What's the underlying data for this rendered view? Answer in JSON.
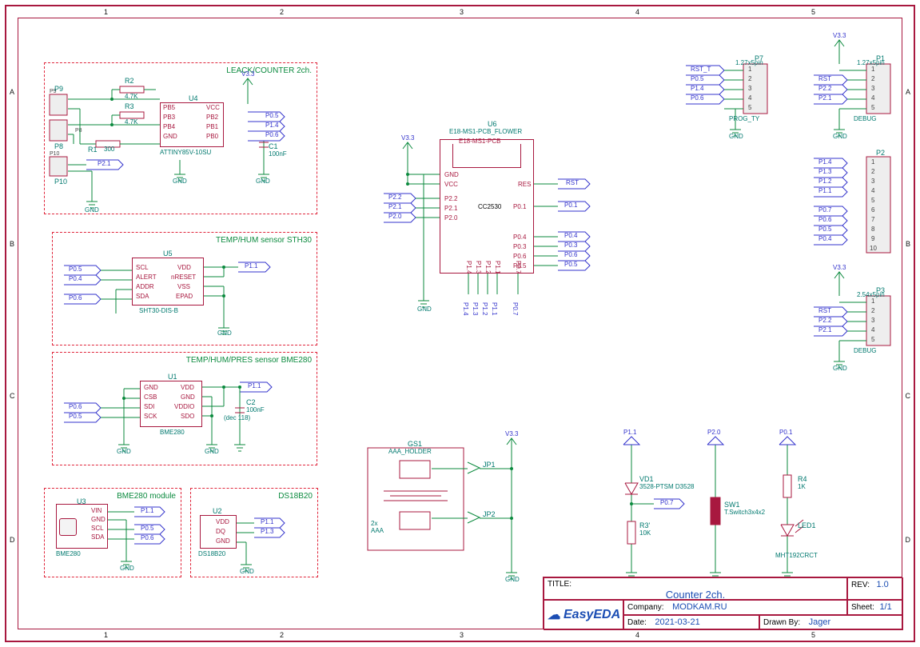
{
  "ruler": {
    "cols": [
      "1",
      "2",
      "3",
      "4",
      "5"
    ],
    "rows": [
      "A",
      "B",
      "C",
      "D"
    ]
  },
  "blocks": {
    "leack": {
      "title": "LEACK/COUNTER 2ch.",
      "u4_ref": "U4",
      "u4_val": "ATTINY85V-10SU",
      "r2_ref": "R2",
      "r2_val": "4.7K",
      "r3_ref": "R3",
      "r3_val": "4.7K",
      "r1_ref": "R1",
      "r1_val": "300",
      "c1_ref": "C1",
      "c1_val": "100nF",
      "p9_ref": "P9",
      "p8_ref": "P8",
      "p10_ref": "P10",
      "v33": "V3.3",
      "u4_pins_left": [
        "PB5",
        "PB3",
        "PB4",
        "GND"
      ],
      "u4_pins_right": [
        "VCC",
        "PB2",
        "PB1",
        "PB0"
      ],
      "nets_right": [
        "P0.5",
        "P1.4",
        "P0.6"
      ],
      "net_p10": "P2.1"
    },
    "sth30": {
      "title": "TEMP/HUM sensor STH30",
      "u5_ref": "U5",
      "u5_val": "SHT30-DIS-B",
      "pins_left": [
        "SCL",
        "ALERT",
        "ADDR",
        "SDA"
      ],
      "pins_right": [
        "VDD",
        "nRESET",
        "VSS",
        "EPAD"
      ],
      "net_scl": "P0.5",
      "net_alert": "P0.4",
      "net_sda": "P0.6",
      "net_vdd": "P1.1"
    },
    "bme280": {
      "title": "TEMP/HUM/PRES sensor BME280",
      "u1_ref": "U1",
      "u1_val": "BME280",
      "pins_left": [
        "GND",
        "CSB",
        "SDI",
        "SCK"
      ],
      "pins_right": [
        "VDD",
        "GND",
        "VDDIO",
        "SDO"
      ],
      "c2_ref": "C2",
      "c2_val": "100nF",
      "note": "(dec 118)",
      "net_sdi": "P0.6",
      "net_sck": "P0.5",
      "net_vdd": "P1.1"
    },
    "bme280_mod": {
      "title": "BME280 module",
      "u3_ref": "U3",
      "u3_val": "BME280",
      "pins": [
        "VIN",
        "GND",
        "SCL",
        "SDA"
      ],
      "net_vin": "P1.1",
      "net_scl": "P0.5",
      "net_sda": "P0.6"
    },
    "ds18b20": {
      "title": "DS18B20",
      "u2_ref": "U2",
      "u2_val": "DS18B20",
      "pins": [
        "VDD",
        "DQ",
        "GND"
      ],
      "net_vdd": "P1.1",
      "net_dq": "P1.3"
    }
  },
  "main_ic": {
    "ref": "U6",
    "lib": "E18-MS1-PCB_FLOWER",
    "val": "E18-MS1-PCB",
    "chip": "CC2530",
    "v33": "V3.3",
    "left_pins": [
      "GND",
      "VCC",
      "P2.2",
      "P2.1",
      "P2.0"
    ],
    "left_nets": [
      "P2.2",
      "P2.1",
      "P2.0"
    ],
    "right_res": "RES",
    "right_res_net": "RST",
    "right_p01": "P0.1",
    "right_p01_net": "P0.1",
    "right_bot_pins": [
      "P0.4",
      "P0.3",
      "P0.6",
      "P0.5"
    ],
    "right_bot_nets": [
      "P0.4",
      "P0.3",
      "P0.6",
      "P0.5"
    ],
    "bot_pins": [
      "P1.4",
      "P1.3",
      "P1.2",
      "P1.1",
      "P0.7"
    ],
    "bot_nets": [
      "P1.4",
      "P1.3",
      "P1.2",
      "P1.1",
      "P0.7"
    ]
  },
  "battery": {
    "ref": "GS1",
    "val": "AAA_HOLDER",
    "note": "2x\nAAA",
    "jp1": "JP1",
    "jp2": "JP2",
    "v33": "V3.3"
  },
  "comp": {
    "vd1_ref": "VD1",
    "vd1_val": "3528-PTSM D3528",
    "r3b_ref": "R3'",
    "r3b_val": "10K",
    "sw1_ref": "SW1",
    "sw1_val": "T.Switch3x4x2",
    "r4_ref": "R4",
    "r4_val": "1K",
    "led1_ref": "LED1",
    "led1_val": "MHT192CRCT",
    "net_p11": "P1.1",
    "net_p20": "P2.0",
    "net_p01": "P0.1",
    "net_p07": "P0.7"
  },
  "connectors": {
    "p7": {
      "ref": "P7",
      "val": "1.27x5pin",
      "pins": [
        "1",
        "2",
        "3",
        "4",
        "5"
      ],
      "nets": [
        "RST_T",
        "P0.5",
        "P1.4",
        "P0.6"
      ],
      "tag": "PROG_TY"
    },
    "p1": {
      "ref": "P1",
      "val": "1.27x5pin",
      "pins": [
        "1",
        "2",
        "3",
        "4",
        "5"
      ],
      "nets": [
        "RST",
        "P2.2",
        "P2.1"
      ],
      "tag": "DEBUG",
      "v33": "V3.3"
    },
    "p2": {
      "ref": "P2",
      "pins": [
        "1",
        "2",
        "3",
        "4",
        "5",
        "6",
        "7",
        "8",
        "9",
        "10"
      ],
      "nets": [
        "P1.4",
        "P1.3",
        "P1.2",
        "P1.1",
        "",
        "P0.7",
        "P0.6",
        "P0.5",
        "P0.4"
      ]
    },
    "p3": {
      "ref": "P3",
      "val": "2.54x5pin",
      "pins": [
        "1",
        "2",
        "3",
        "4",
        "5"
      ],
      "nets": [
        "RST",
        "P2.2",
        "P2.1"
      ],
      "tag": "DEBUG",
      "v33": "V3.3"
    }
  },
  "title_block": {
    "title_key": "TITLE:",
    "title": "Counter 2ch.",
    "rev_key": "REV:",
    "rev": "1.0",
    "company_key": "Company:",
    "company": "MODKAM.RU",
    "sheet_key": "Sheet:",
    "sheet": "1/1",
    "date_key": "Date:",
    "date": "2021-03-21",
    "drawn_key": "Drawn By:",
    "drawn": "Jager",
    "logo": "EasyEDA"
  }
}
